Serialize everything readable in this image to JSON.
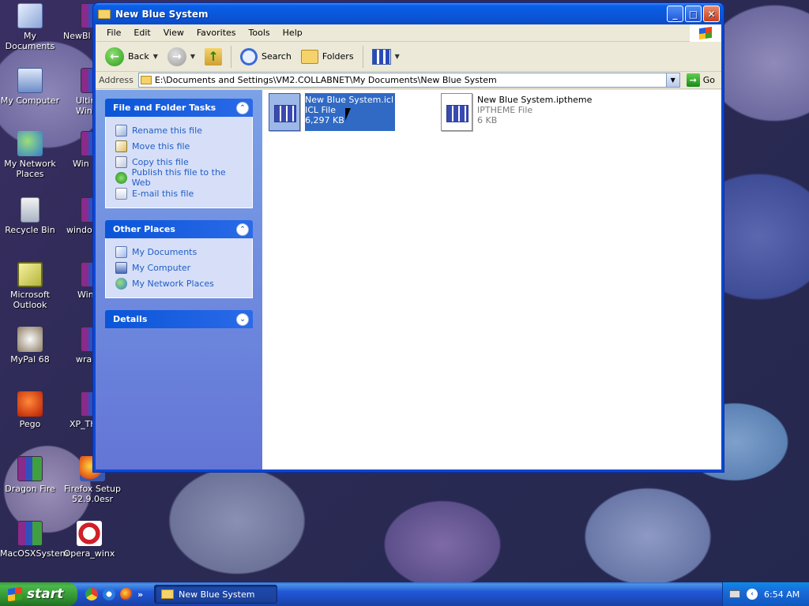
{
  "desktop": {
    "icons": [
      {
        "label": "My Documents"
      },
      {
        "label": "NewBl"
      },
      {
        "label": "My Computer"
      },
      {
        "label": "Ultim Windo"
      },
      {
        "label": "My Network Places"
      },
      {
        "label": "Win"
      },
      {
        "label": "Recycle Bin"
      },
      {
        "label": "window"
      },
      {
        "label": "Microsoft Outlook"
      },
      {
        "label": "Winl"
      },
      {
        "label": "MyPal 68"
      },
      {
        "label": "wra"
      },
      {
        "label": "Pego"
      },
      {
        "label": "XP_Th"
      },
      {
        "label": "Dragon Fire"
      },
      {
        "label": "Firefox Setup 52.9.0esr"
      },
      {
        "label": "MacOSXSystem"
      },
      {
        "label": "Opera_winx"
      }
    ]
  },
  "window": {
    "title": "New Blue System",
    "menu": [
      "File",
      "Edit",
      "View",
      "Favorites",
      "Tools",
      "Help"
    ],
    "toolbar": {
      "back_label": "Back",
      "search_label": "Search",
      "folders_label": "Folders"
    },
    "address": {
      "label": "Address",
      "value": "E:\\Documents and Settings\\VM2.COLLABNET\\My Documents\\New Blue System",
      "go_label": "Go"
    },
    "taskpane": {
      "file_tasks": {
        "title": "File and Folder Tasks",
        "links": [
          "Rename this file",
          "Move this file",
          "Copy this file",
          "Publish this file to the Web",
          "E-mail this file"
        ]
      },
      "other_places": {
        "title": "Other Places",
        "links": [
          "My Documents",
          "My Computer",
          "My Network Places"
        ]
      },
      "details": {
        "title": "Details"
      }
    },
    "files": [
      {
        "name": "New Blue System.icl",
        "type": "ICL File",
        "size": "6,297 KB",
        "selected": true
      },
      {
        "name": "New Blue System.iptheme",
        "type": "IPTHEME File",
        "size": "6 KB",
        "selected": false
      }
    ]
  },
  "taskbar": {
    "start_label": "start",
    "quicklaunch_more": "»",
    "task_label": "New Blue System",
    "clock": "6:54 AM"
  }
}
